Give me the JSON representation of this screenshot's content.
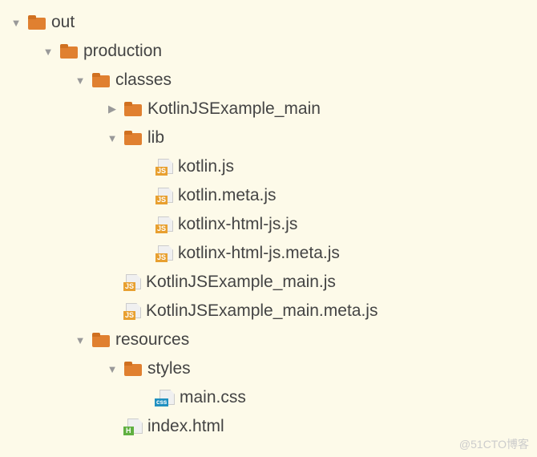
{
  "tree": {
    "out": "out",
    "production": "production",
    "classes": "classes",
    "kjse_main_dir": "KotlinJSExample_main",
    "lib": "lib",
    "kotlin_js": "kotlin.js",
    "kotlin_meta_js": "kotlin.meta.js",
    "kotlinx_html_js": "kotlinx-html-js.js",
    "kotlinx_html_meta_js": "kotlinx-html-js.meta.js",
    "kjse_main_js": "KotlinJSExample_main.js",
    "kjse_main_meta_js": "KotlinJSExample_main.meta.js",
    "resources": "resources",
    "styles": "styles",
    "main_css": "main.css",
    "index_html": "index.html"
  },
  "watermark": "@51CTO博客"
}
